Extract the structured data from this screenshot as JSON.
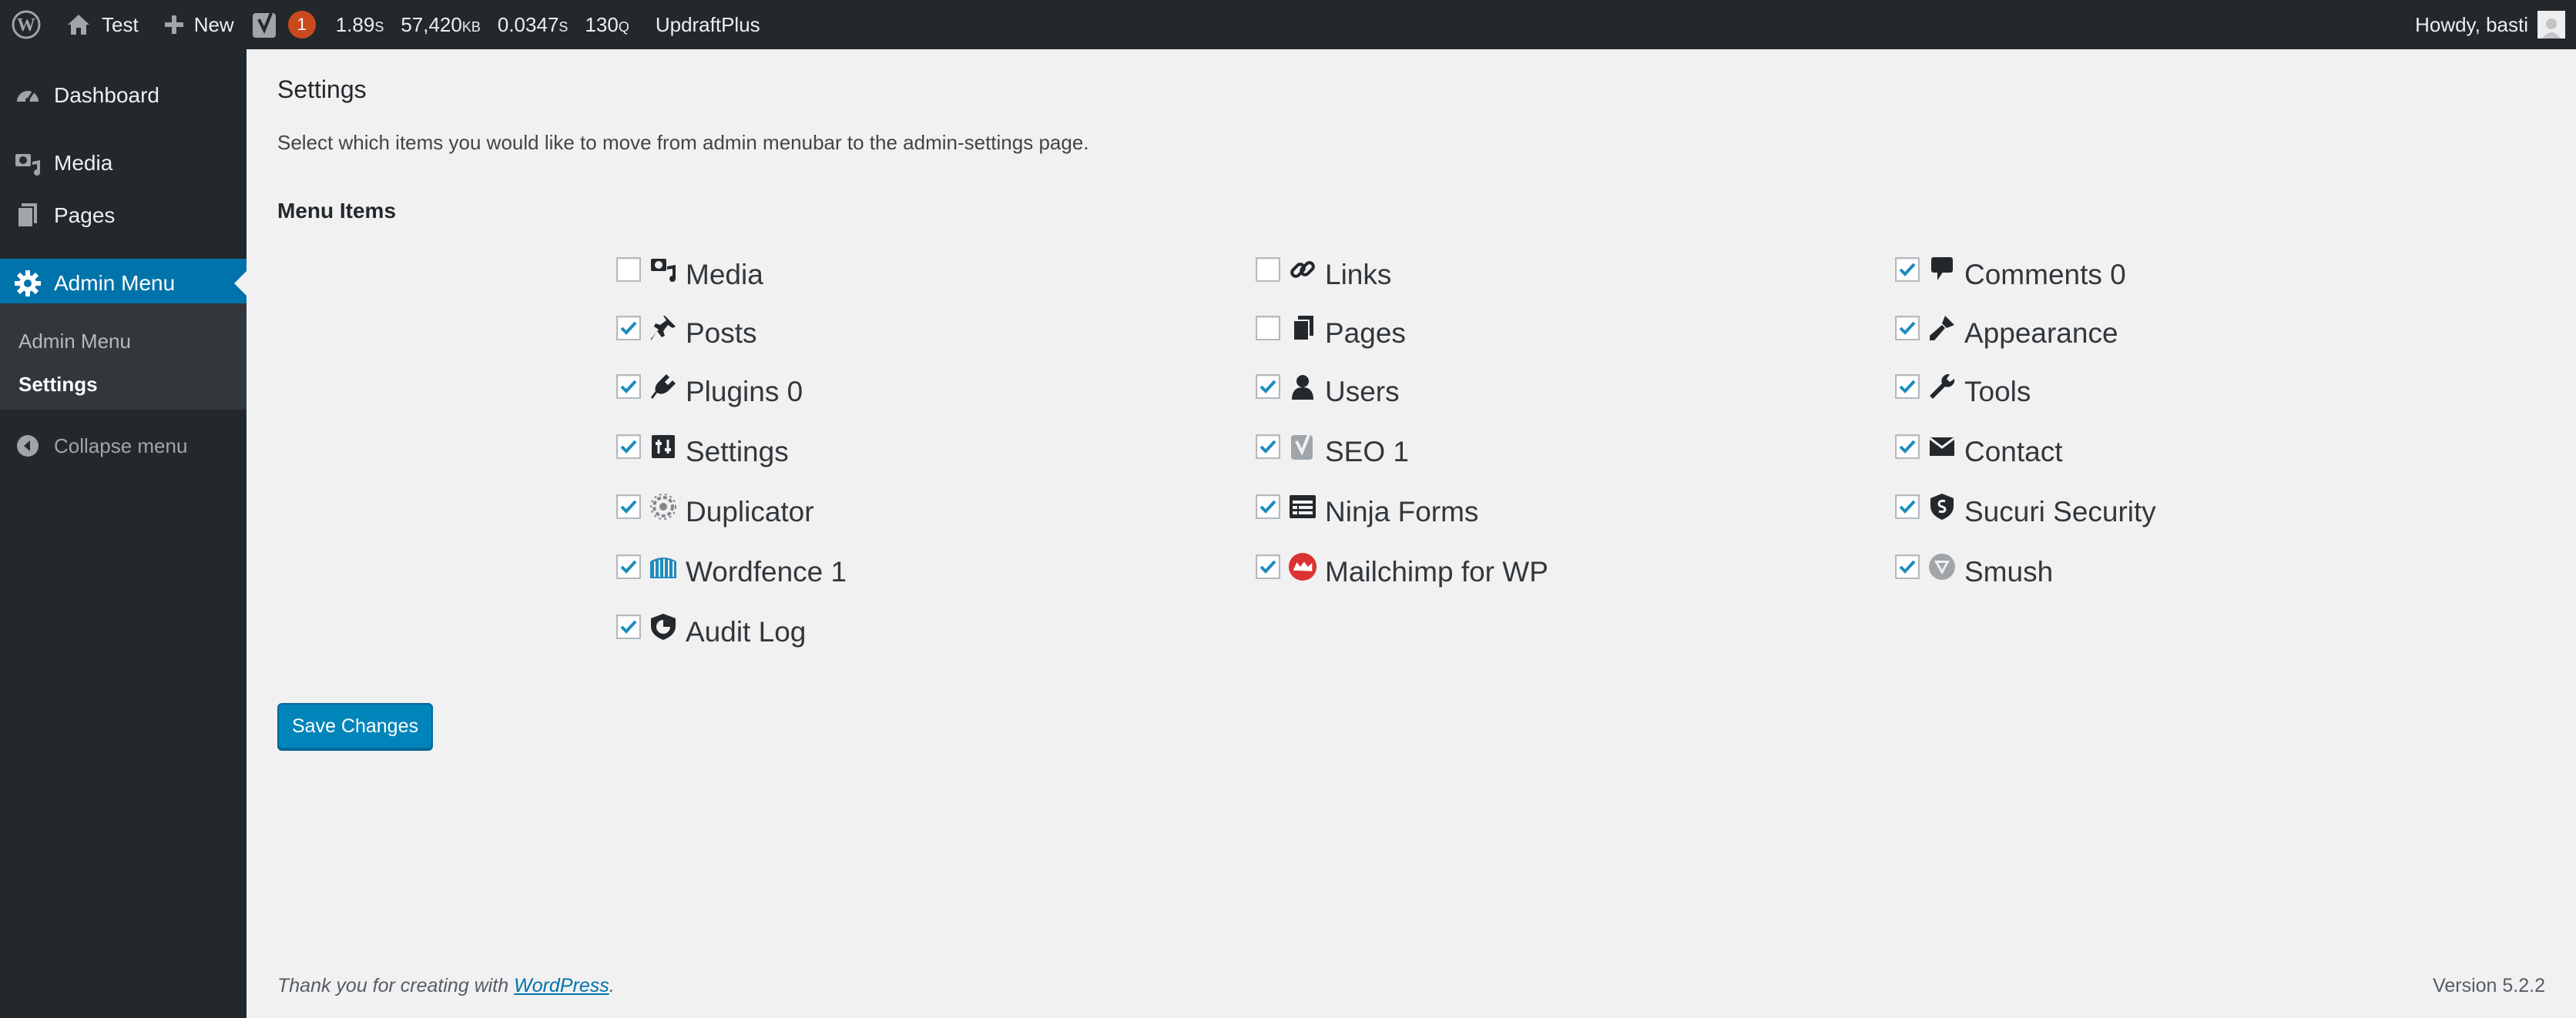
{
  "adminbar": {
    "site_name": "Test",
    "new_label": "New",
    "seo_count": "1",
    "time_value": "1.89",
    "time_unit": "S",
    "memory_value": "57,420",
    "memory_unit": "KB",
    "query_time_value": "0.0347",
    "query_time_unit": "S",
    "queries_value": "130",
    "queries_unit": "Q",
    "updraftplus_label": "UpdraftPlus",
    "howdy": "Howdy, basti"
  },
  "sidebar": {
    "dashboard": "Dashboard",
    "media": "Media",
    "pages": "Pages",
    "admin_menu": "Admin Menu",
    "submenu": [
      "Admin Menu",
      "Settings"
    ],
    "collapse": "Collapse menu"
  },
  "main": {
    "title": "Settings",
    "description": "Select which items you would like to move from admin menubar to the admin-settings page.",
    "menu_items_label": "Menu Items",
    "options": [
      {
        "label": "Media",
        "checked": false,
        "icon": "media-icon"
      },
      {
        "label": "Posts",
        "checked": true,
        "icon": "pin-icon"
      },
      {
        "label": "Plugins 0",
        "checked": true,
        "icon": "plugin-icon"
      },
      {
        "label": "Settings",
        "checked": true,
        "icon": "settings-icon"
      },
      {
        "label": "Duplicator",
        "checked": true,
        "icon": "duplicator-icon"
      },
      {
        "label": "Wordfence 1",
        "checked": true,
        "icon": "wordfence-icon"
      },
      {
        "label": "Audit Log",
        "checked": true,
        "icon": "audit-log-icon"
      },
      {
        "label": "Links",
        "checked": false,
        "icon": "link-icon"
      },
      {
        "label": "Pages",
        "checked": false,
        "icon": "pages-icon"
      },
      {
        "label": "Users",
        "checked": true,
        "icon": "user-icon"
      },
      {
        "label": "SEO 1",
        "checked": true,
        "icon": "yoast-icon"
      },
      {
        "label": "Ninja Forms",
        "checked": true,
        "icon": "ninja-forms-icon"
      },
      {
        "label": "Mailchimp for WP",
        "checked": true,
        "icon": "mailchimp-icon"
      },
      {
        "label": "Comments 0",
        "checked": true,
        "icon": "comment-icon"
      },
      {
        "label": "Appearance",
        "checked": true,
        "icon": "brush-icon"
      },
      {
        "label": "Tools",
        "checked": true,
        "icon": "wrench-icon"
      },
      {
        "label": "Contact",
        "checked": true,
        "icon": "envelope-icon"
      },
      {
        "label": "Sucuri Security",
        "checked": true,
        "icon": "sucuri-icon"
      },
      {
        "label": "Smush",
        "checked": true,
        "icon": "smush-icon"
      }
    ],
    "save_label": "Save Changes"
  },
  "footer": {
    "thanks_prefix": "Thank you for creating with ",
    "wordpress_link": "WordPress",
    "thanks_suffix": ".",
    "version": "Version 5.2.2"
  },
  "colors": {
    "adminbar_bg": "#23282d",
    "accent": "#0073aa",
    "button": "#0085ba",
    "notification": "#ca4a1f",
    "check": "#1e8cbe"
  }
}
